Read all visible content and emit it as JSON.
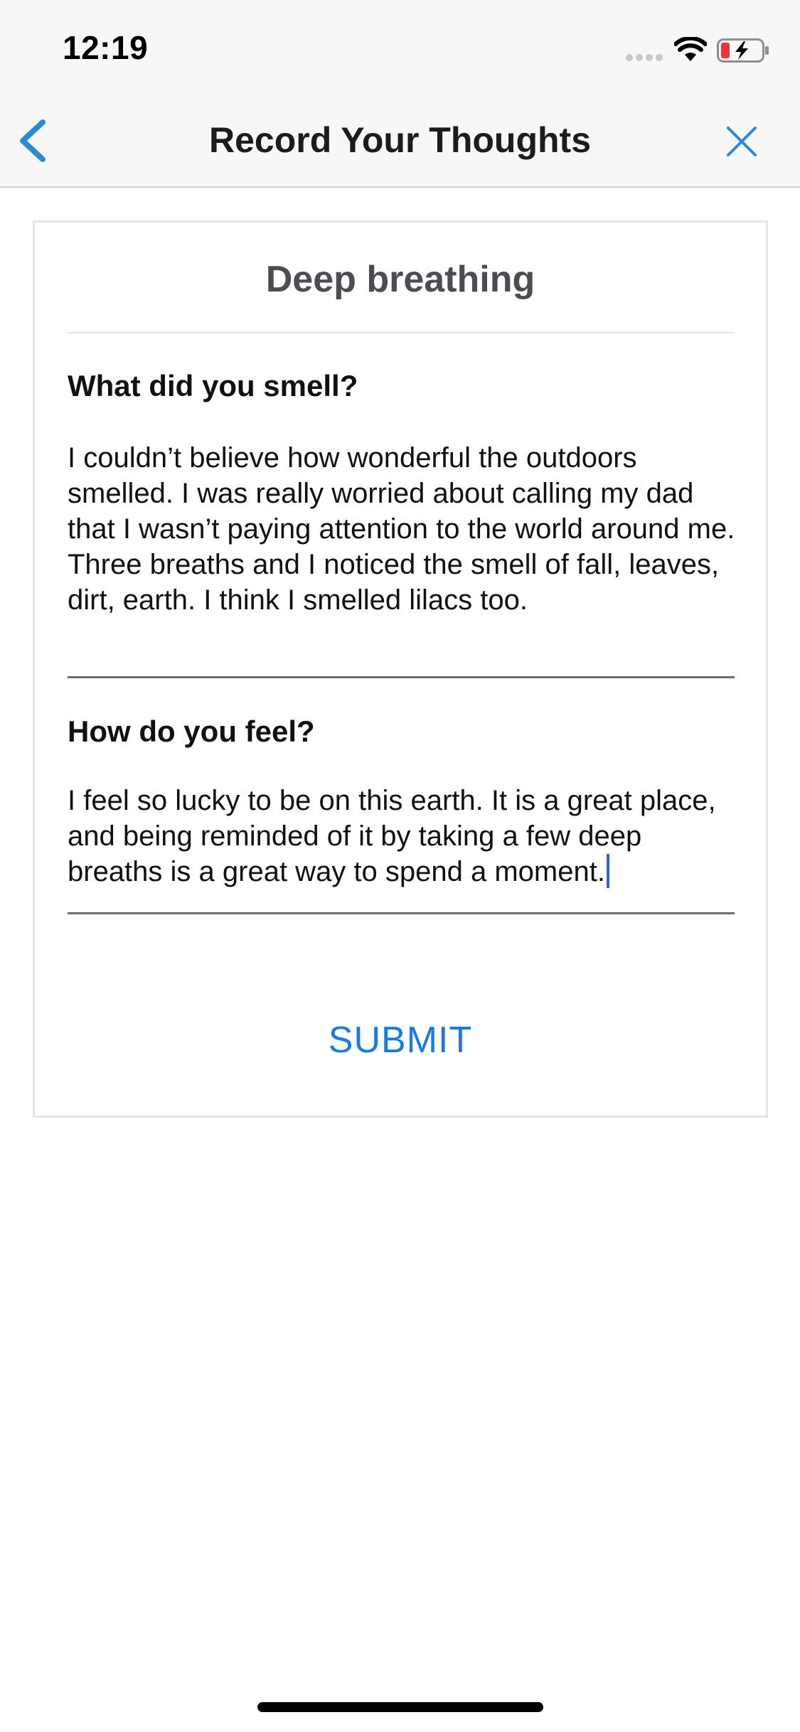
{
  "status_bar": {
    "time": "12:19"
  },
  "nav": {
    "title": "Record Your Thoughts",
    "back_icon": "chevron-left-icon",
    "close_icon": "close-icon",
    "accent_color": "#2b8ad8"
  },
  "card": {
    "title": "Deep breathing",
    "questions": [
      {
        "label": "What did you smell?",
        "answer": "I couldn’t believe how wonderful the outdoors smelled. I was really worried about calling my dad that I wasn’t paying attention to the world around me. Three breaths and I noticed the smell of fall, leaves, dirt, earth. I think I smelled lilacs too."
      },
      {
        "label": "How do you feel?",
        "answer": "I feel so lucky to be on this earth. It is a great place, and being reminded of it by taking a few deep breaths is a great way to spend a moment."
      }
    ],
    "submit_label": "SUBMIT",
    "submit_color": "#1a7ae0"
  }
}
